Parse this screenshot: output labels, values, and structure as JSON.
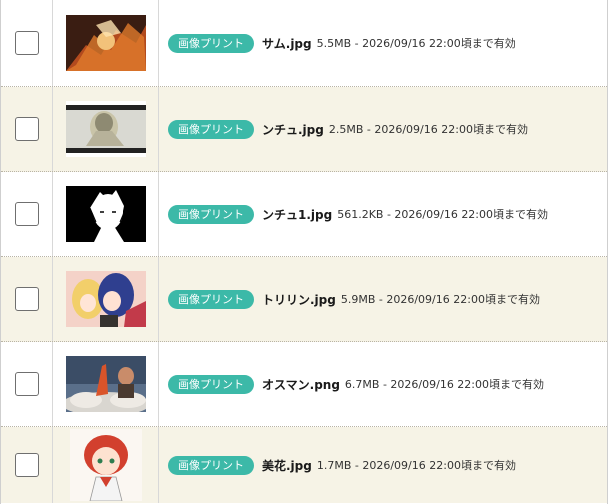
{
  "badge_label": "画像プリント",
  "checkbox_state": "unchecked",
  "files": [
    {
      "name": "サム.jpg",
      "meta": "5.5MB - 2026/09/16 22:00頃まで有効"
    },
    {
      "name": "ンチュ.jpg",
      "meta": "2.5MB - 2026/09/16 22:00頃まで有効"
    },
    {
      "name": "ンチュ1.jpg",
      "meta": "561.2KB - 2026/09/16 22:00頃まで有効"
    },
    {
      "name": "トリリン.jpg",
      "meta": "5.9MB - 2026/09/16 22:00頃まで有効"
    },
    {
      "name": "オスマン.png",
      "meta": "6.7MB - 2026/09/16 22:00頃まで有効"
    },
    {
      "name": "美花.jpg",
      "meta": "1.7MB - 2026/09/16 22:00頃まで有効"
    }
  ],
  "colors": {
    "badge": "#3cb9a8",
    "row_alt": "#f6f3e6"
  }
}
